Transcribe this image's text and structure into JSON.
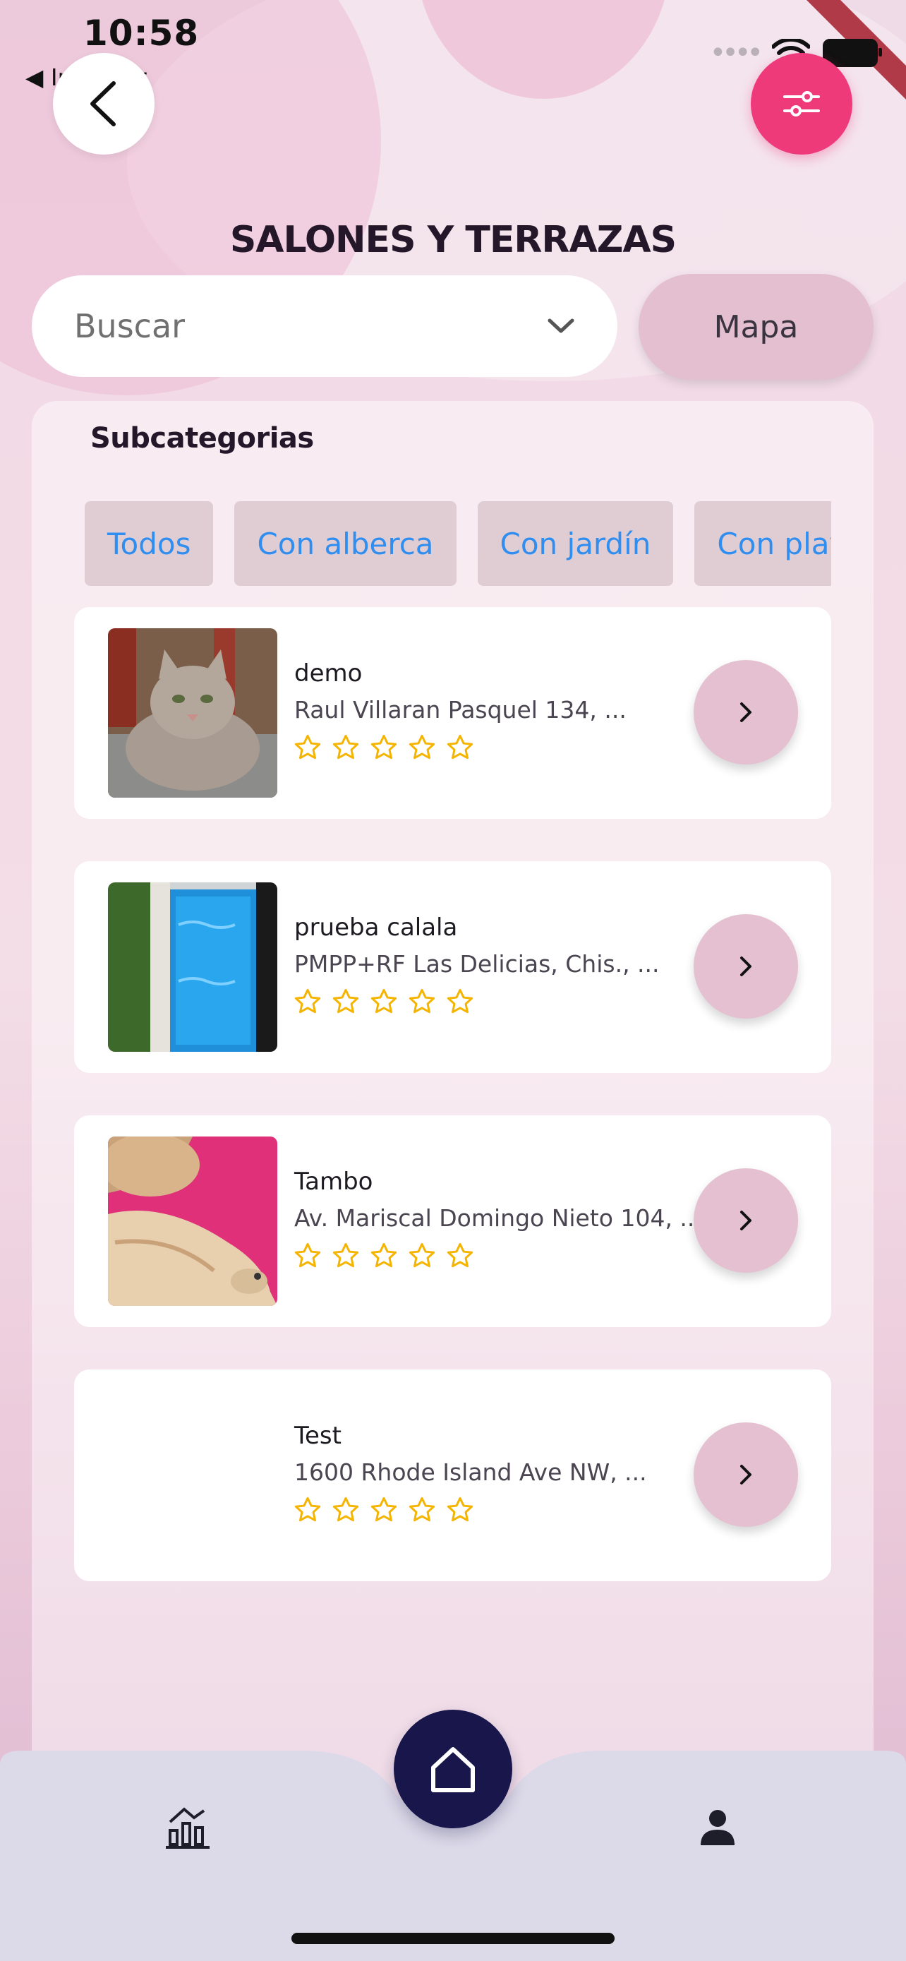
{
  "status_bar": {
    "time": "10:58",
    "back_app": "◀ Iplanner"
  },
  "header": {
    "title": "SALONES Y TERRAZAS"
  },
  "search": {
    "placeholder": "Buscar",
    "map_label": "Mapa"
  },
  "subcategories": {
    "title": "Subcategorias",
    "chips": [
      "Todos",
      "Con alberca",
      "Con jardín",
      "Con playa"
    ]
  },
  "listings": [
    {
      "name": "demo",
      "address": "Raul Villaran Pasquel 134, ...",
      "rating": 0,
      "image": "cat-photo"
    },
    {
      "name": "prueba calala",
      "address": "PMPP+RF Las Delicias, Chis., ...",
      "rating": 0,
      "image": "pool-photo"
    },
    {
      "name": "Tambo",
      "address": "Av. Mariscal Domingo Nieto 104, ...",
      "rating": 0,
      "image": "dog-photo"
    },
    {
      "name": "Test",
      "address": "1600 Rhode Island Ave NW, ...",
      "rating": 0,
      "image": "none"
    }
  ],
  "nav": {
    "left_icon": "stats-icon",
    "center_icon": "home-icon",
    "right_icon": "profile-icon"
  },
  "colors": {
    "accent": "#ef3a7a",
    "nav_dark": "#18164a",
    "chip_text": "#2f8ef0",
    "star": "#f5b400"
  }
}
